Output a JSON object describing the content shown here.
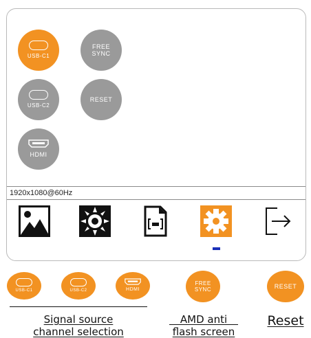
{
  "osd": {
    "buttons": {
      "usb_c1": "USB-C1",
      "free_sync": "FREE\nSYNC",
      "usb_c2": "USB-C2",
      "reset": "RESET",
      "hdmi": "HDMI"
    },
    "status": {
      "resolution": "1920x1080@60Hz"
    },
    "menu": {
      "items": [
        "image-icon",
        "brightness-icon",
        "document-icon",
        "settings-icon",
        "exit-icon"
      ],
      "selected": "settings-icon"
    },
    "colors": {
      "accent": "#f29222",
      "inactive": "#9a9a9a",
      "indicator": "#1a2fb8"
    }
  },
  "legend": {
    "buttons": {
      "usb_c1": "USB-C1",
      "usb_c2": "USB-C2",
      "hdmi": "HDMI",
      "free_sync": "FREE\nSYNC",
      "reset": "RESET"
    },
    "captions": {
      "signal_source": "Signal source\nchannel selection",
      "amd_anti_flash": "AMD anti\nflash screen",
      "reset": "Reset"
    }
  }
}
